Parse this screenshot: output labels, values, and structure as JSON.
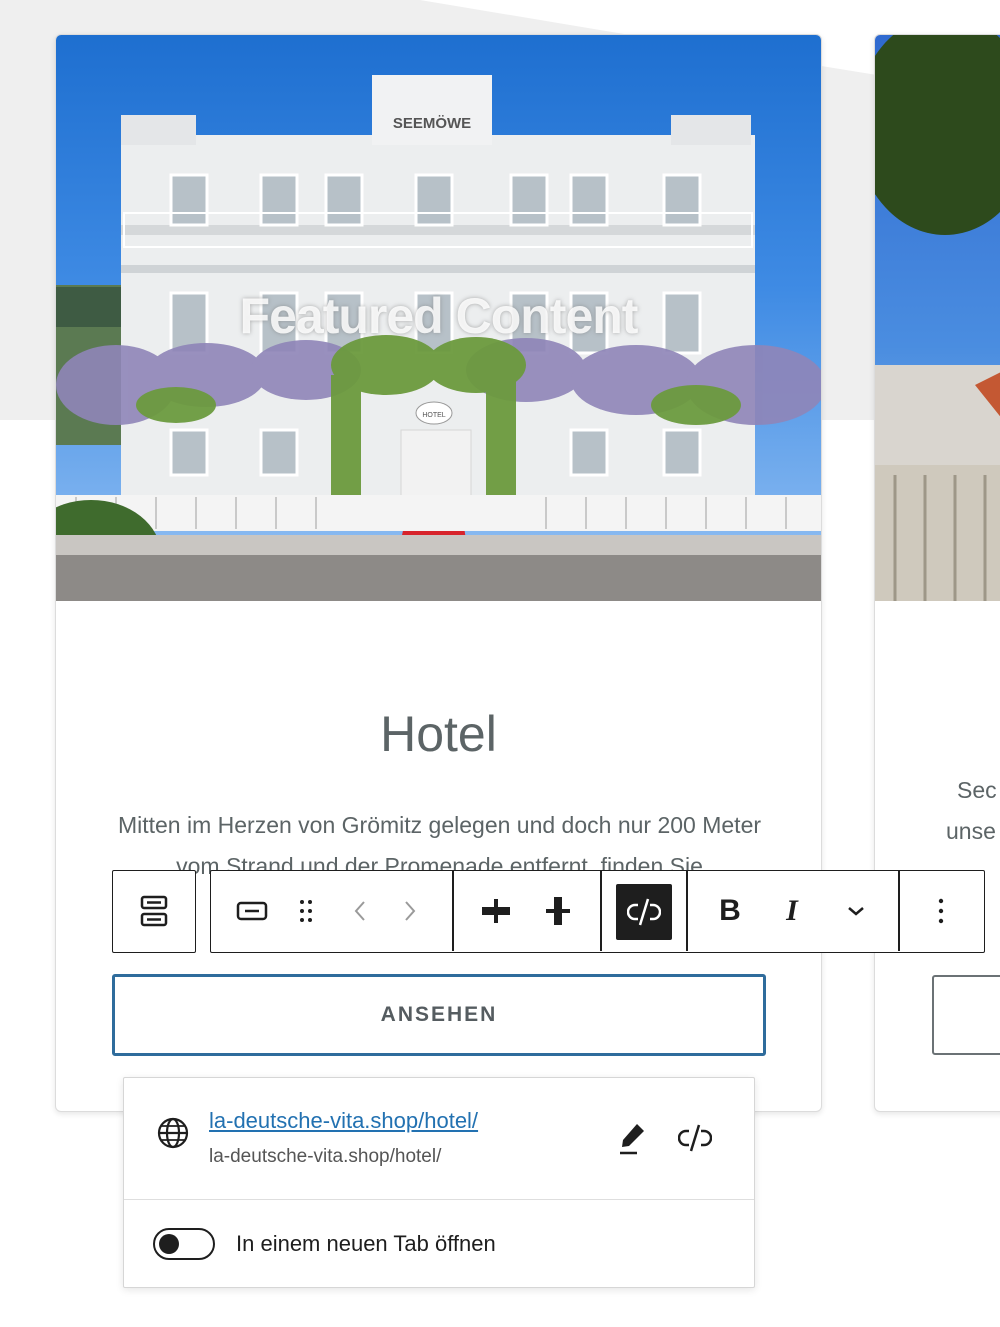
{
  "card": {
    "image_caption": "SEEMÖWE",
    "hotel_sign": "HOTEL",
    "overlay_text": "Featured Content",
    "title": "Hotel",
    "description": "Mitten im Herzen von Grömitz gelegen und doch nur 200 Meter vom Strand und der Promenade entfernt, finden Sie",
    "button_label": "ANSEHEN"
  },
  "next_card": {
    "text_line1": "Sec",
    "text_line2": "unse"
  },
  "toolbar": {
    "icons": [
      "group-icon",
      "button-icon",
      "drag-handle-icon",
      "chevron-left-icon",
      "chevron-right-icon",
      "justify-horizontal-icon",
      "justify-vertical-icon",
      "link-off-icon",
      "bold-icon",
      "italic-icon",
      "chevron-down-icon",
      "more-vertical-icon"
    ],
    "bold": "B",
    "italic": "I"
  },
  "link_popover": {
    "url_label": "la-deutsche-vita.shop/hotel/",
    "url_sub": "la-deutsche-vita.shop/hotel/",
    "new_tab_label": "In einem neuen Tab öffnen",
    "new_tab_enabled": false
  },
  "colors": {
    "accent": "#2f6c9c",
    "link": "#2271b1",
    "toolbar_active": "#1e1e1e"
  }
}
